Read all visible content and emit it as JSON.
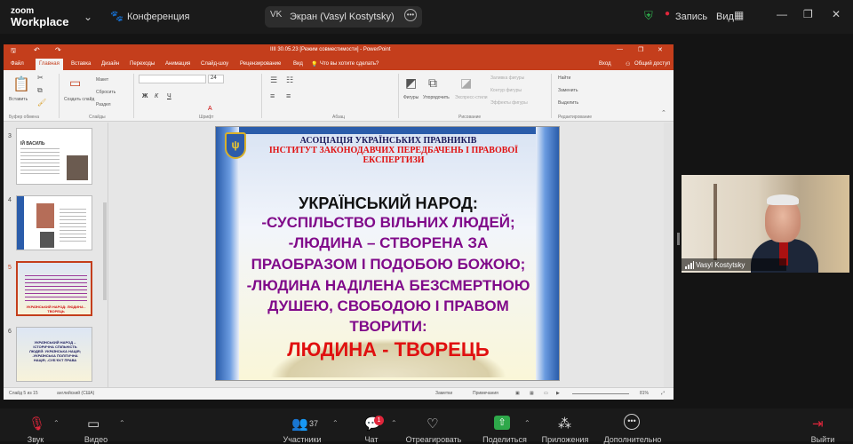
{
  "zoom": {
    "logo_top": "zoom",
    "logo_bottom": "Workplace",
    "meeting_label": "Конференция",
    "share": {
      "initials": "VK",
      "title": "Экран (Vasyl Kostytsky)"
    },
    "recording_label": "Запись",
    "view_label": "Вид"
  },
  "ppt": {
    "window_title": "ІІІІ 30.05.23 [Режим совместимости] - PowerPoint",
    "tabs": [
      "Файл",
      "Главная",
      "Вставка",
      "Дизайн",
      "Переходы",
      "Анимация",
      "Слайд-шоу",
      "Рецензирование",
      "Вид"
    ],
    "tell_me": "Что вы хотите сделать?",
    "sign_in": "Вход",
    "share": "Общий доступ",
    "ribbon": {
      "paste": "Вставить",
      "layout": "Макет",
      "reset": "Сбросить",
      "section": "Раздел",
      "new_slide": "Создать слайд",
      "font_size": "24",
      "shapes": "Фигуры",
      "arrange": "Упорядочить",
      "quick_styles": "Экспресс-стили",
      "fill": "Заливка фигуры",
      "outline": "Контур фигуры",
      "effects": "Эффекты фигуры",
      "find": "Найти",
      "replace": "Заменить",
      "select": "Выделить",
      "groups": [
        "Буфер обмена",
        "Слайды",
        "Шрифт",
        "Абзац",
        "Рисование",
        "Редактирование"
      ]
    },
    "thumbs": [
      {
        "num": "3",
        "text": "ІЙ ВАСИЛЬ"
      },
      {
        "num": "4",
        "text": ""
      },
      {
        "num": "5",
        "text": "УКРАЇНСЬКИЙ НАРОД: ЛЮДИНА - ТВОРЕЦЬ"
      },
      {
        "num": "6",
        "text": "УКРАЇНСЬКИЙ НАРОД – ІСТОРИЧНА СПІЛЬНІСТЬ ЛЮДЕЙ: УКРАЇНСЬКА НАЦІЯ; -УКРАЇНСЬКА ПОЛІТИЧНА НАЦІЯ; -СУБ’ЄКТ ПРАВА"
      }
    ],
    "status": {
      "slide_of": "Слайд 5 из 15",
      "language": "английский (США)",
      "notes": "Заметки",
      "comments": "Примечания",
      "zoom": "81%"
    }
  },
  "slide": {
    "association": "АСОЦІАЦІЯ УКРАЇНСЬКИХ ПРАВНИКІВ",
    "institute_line1": "ІНСТИТУТ ЗАКОНОДАВЧИХ ПЕРЕДБАЧЕНЬ І ПРАВОВОЇ",
    "institute_line2": "ЕКСПЕРТИЗИ",
    "heading": "УКРАЇНСЬКИЙ НАРОД:",
    "lines": [
      "-СУСПІЛЬСТВО ВІЛЬНИХ ЛЮДЕЙ;",
      "-ЛЮДИНА – СТВОРЕНА ЗА",
      "ПРАОБРАЗОМ І ПОДОБОЮ БОЖОЮ;",
      "-ЛЮДИНА НАДІЛЕНА БЕЗСМЕРТНОЮ",
      "ДУШЕЮ, СВОБОДОЮ І ПРАВОМ",
      "ТВОРИТИ:"
    ],
    "conclusion": "ЛЮДИНА - ТВОРЕЦЬ"
  },
  "video": {
    "name": "Vasyl Kostytsky"
  },
  "toolbar": {
    "participants_count": "37",
    "chat_badge": "1",
    "items": [
      "Звук",
      "Видео",
      "Участники",
      "Чат",
      "Отреагировать",
      "Поделиться",
      "Приложения",
      "Дополнительно",
      "Выйти"
    ]
  },
  "colors": {
    "ppt_accent": "#c43e1c",
    "slide_red": "#e01010",
    "slide_purple": "#800a8a",
    "share_green": "#2ea84a"
  }
}
